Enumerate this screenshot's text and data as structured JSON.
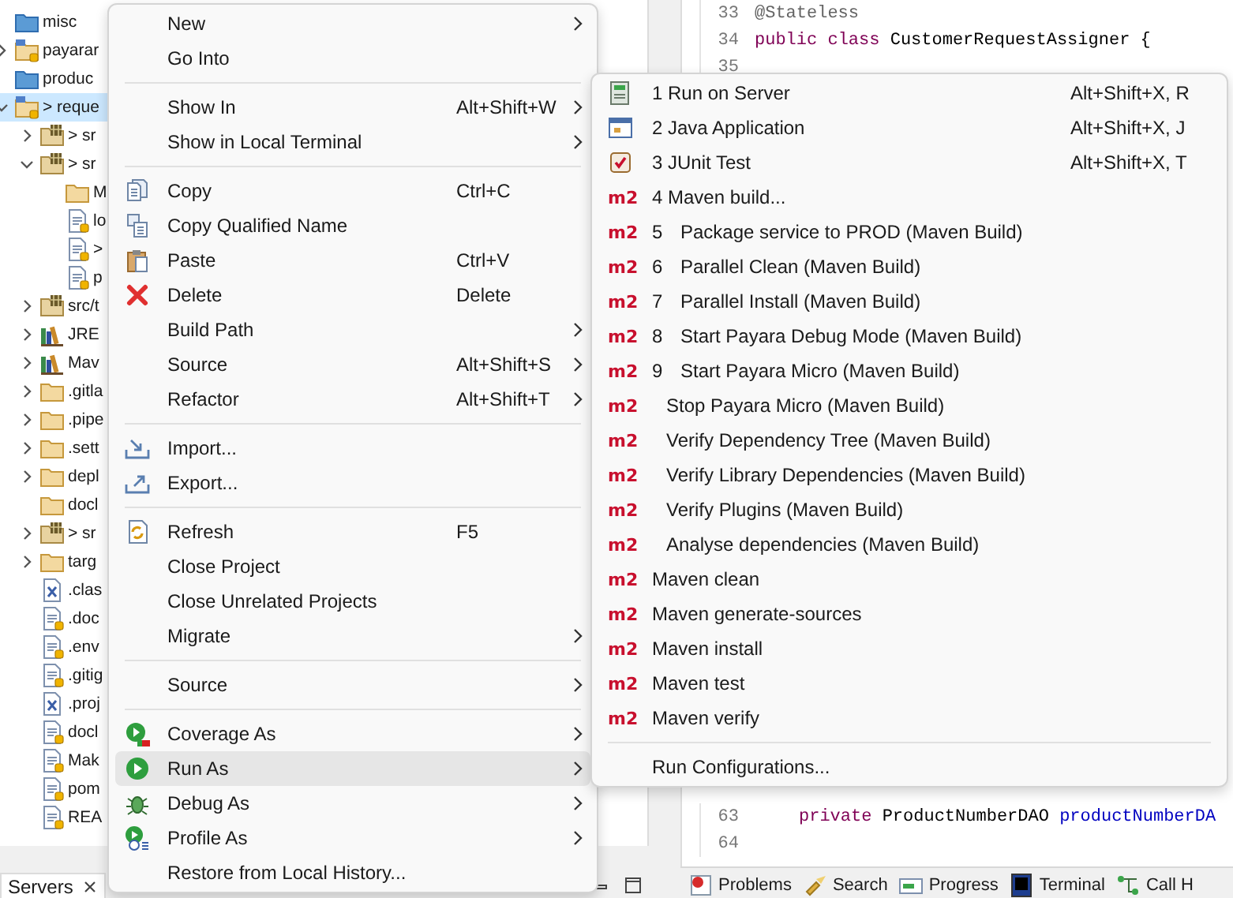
{
  "project_explorer": {
    "items": [
      {
        "label": "misc",
        "kind": "closed-folder",
        "selected": false
      },
      {
        "label": "payarar",
        "kind": "project",
        "expanded": false,
        "selected": false
      },
      {
        "label": "produc",
        "kind": "closed-folder",
        "selected": false
      },
      {
        "label": "> reque",
        "kind": "project",
        "expanded": true,
        "selected": true,
        "children": [
          {
            "label": "> sr",
            "kind": "source-folder",
            "expanded": false,
            "selected": false
          },
          {
            "label": "> sr",
            "kind": "source-folder",
            "expanded": true,
            "selected": false,
            "children": [
              {
                "label": "M",
                "kind": "folder",
                "selected": false
              },
              {
                "label": "lo",
                "kind": "file",
                "selected": false
              },
              {
                "label": ">",
                "kind": "file",
                "selected": false
              },
              {
                "label": "p",
                "kind": "file",
                "selected": false
              }
            ]
          },
          {
            "label": "src/t",
            "kind": "source-folder",
            "expanded": false,
            "selected": false
          },
          {
            "label": "JRE",
            "kind": "library",
            "expanded": false,
            "selected": false
          },
          {
            "label": "Mav",
            "kind": "library",
            "expanded": false,
            "selected": false
          },
          {
            "label": ".gitla",
            "kind": "folder",
            "expanded": false,
            "selected": false
          },
          {
            "label": ".pipe",
            "kind": "folder",
            "expanded": false,
            "selected": false
          },
          {
            "label": ".sett",
            "kind": "folder",
            "expanded": false,
            "selected": false
          },
          {
            "label": "depl",
            "kind": "folder",
            "expanded": false,
            "selected": false
          },
          {
            "label": "docl",
            "kind": "folder",
            "selected": false
          },
          {
            "label": "> sr",
            "kind": "source-folder",
            "expanded": false,
            "selected": false
          },
          {
            "label": "targ",
            "kind": "folder",
            "expanded": false,
            "selected": false
          },
          {
            "label": ".clas",
            "kind": "xml-file",
            "selected": false
          },
          {
            "label": ".doc",
            "kind": "file",
            "selected": false
          },
          {
            "label": ".env",
            "kind": "file",
            "selected": false
          },
          {
            "label": ".gitig",
            "kind": "file",
            "selected": false
          },
          {
            "label": ".proj",
            "kind": "xml-file",
            "selected": false
          },
          {
            "label": "docl",
            "kind": "file",
            "selected": false
          },
          {
            "label": "Mak",
            "kind": "file",
            "selected": false
          },
          {
            "label": "pom",
            "kind": "file",
            "selected": false
          },
          {
            "label": "REA",
            "kind": "file",
            "selected": false
          }
        ]
      }
    ]
  },
  "servers_tab": {
    "label": "Servers"
  },
  "editor": {
    "top_lines": [
      {
        "number": "33",
        "tokens": [
          {
            "kind": "annotation",
            "text": "@Stateless"
          }
        ]
      },
      {
        "number": "34",
        "tokens": [
          {
            "kind": "keyword",
            "text": "public"
          },
          {
            "kind": "keyword",
            "text": "class"
          },
          {
            "kind": "plain",
            "text": "CustomerRequestAssigner {"
          }
        ]
      },
      {
        "number": "35"
      }
    ],
    "bottom_lines": [
      {
        "number": "63",
        "indented": true,
        "tokens": [
          {
            "kind": "keyword",
            "text": "private"
          },
          {
            "kind": "plain",
            "text": "ProductNumberDAO"
          },
          {
            "kind": "field",
            "text": "productNumberDA"
          }
        ]
      },
      {
        "number": "64"
      }
    ]
  },
  "bottom_tabs": [
    {
      "label": "Problems",
      "kind": "problems"
    },
    {
      "label": "Search",
      "kind": "search"
    },
    {
      "label": "Progress",
      "kind": "progress"
    },
    {
      "label": "Terminal",
      "kind": "terminal"
    },
    {
      "label": "Call H",
      "kind": "call"
    }
  ],
  "context_menu": {
    "groups": [
      [
        {
          "label": "New",
          "has_submenu": true,
          "selected": false
        },
        {
          "label": "Go Into",
          "selected": false
        }
      ],
      [
        {
          "label": "Show In",
          "shortcut": "Alt+Shift+W",
          "has_submenu": true,
          "selected": false
        },
        {
          "label": "Show in Local Terminal",
          "has_submenu": true,
          "selected": false
        }
      ],
      [
        {
          "label": "Copy",
          "kind": "copy",
          "shortcut": "Ctrl+C",
          "selected": false
        },
        {
          "label": "Copy Qualified Name",
          "kind": "copy-qualified",
          "selected": false
        },
        {
          "label": "Paste",
          "kind": "paste",
          "shortcut": "Ctrl+V",
          "selected": false
        },
        {
          "label": "Delete",
          "kind": "delete",
          "shortcut": "Delete",
          "selected": false
        },
        {
          "label": "Build Path",
          "has_submenu": true,
          "selected": false
        },
        {
          "label": "Source",
          "shortcut": "Alt+Shift+S",
          "has_submenu": true,
          "selected": false
        },
        {
          "label": "Refactor",
          "shortcut": "Alt+Shift+T",
          "has_submenu": true,
          "selected": false
        }
      ],
      [
        {
          "label": "Import...",
          "kind": "import",
          "selected": false
        },
        {
          "label": "Export...",
          "kind": "export",
          "selected": false
        }
      ],
      [
        {
          "label": "Refresh",
          "kind": "refresh",
          "shortcut": "F5",
          "selected": false
        },
        {
          "label": "Close Project",
          "selected": false
        },
        {
          "label": "Close Unrelated Projects",
          "selected": false
        },
        {
          "label": "Migrate",
          "has_submenu": true,
          "selected": false
        }
      ],
      [
        {
          "label": "Source",
          "has_submenu": true,
          "selected": false
        }
      ],
      [
        {
          "label": "Coverage As",
          "kind": "coverage",
          "has_submenu": true,
          "selected": false
        },
        {
          "label": "Run As",
          "kind": "run",
          "has_submenu": true,
          "selected": true
        },
        {
          "label": "Debug As",
          "kind": "debug",
          "has_submenu": true,
          "selected": false
        },
        {
          "label": "Profile As",
          "kind": "profile",
          "has_submenu": true,
          "selected": false
        },
        {
          "label": "Restore from Local History...",
          "selected": false
        }
      ]
    ]
  },
  "run_as_submenu": {
    "groups": [
      [
        {
          "kind": "server",
          "label": "1 Run on Server",
          "shortcut": "Alt+Shift+X, R",
          "selected": false
        },
        {
          "kind": "java",
          "label": "2 Java Application",
          "shortcut": "Alt+Shift+X, J",
          "selected": false
        },
        {
          "kind": "junit",
          "label": "3 JUnit Test",
          "shortcut": "Alt+Shift+X, T",
          "selected": false
        },
        {
          "kind": "maven-goal",
          "label": "4 Maven build...",
          "badge": "m2",
          "selected": false
        },
        {
          "kind": "maven-config",
          "number": "5",
          "label": "Package service to PROD (Maven Build)",
          "badge": "m2",
          "selected": false
        },
        {
          "kind": "maven-config",
          "number": "6",
          "label": "Parallel Clean (Maven Build)",
          "badge": "m2",
          "selected": false
        },
        {
          "kind": "maven-config",
          "number": "7",
          "label": "Parallel Install (Maven Build)",
          "badge": "m2",
          "selected": false
        },
        {
          "kind": "maven-config",
          "number": "8",
          "label": "Start Payara Debug Mode (Maven Build)",
          "badge": "m2",
          "selected": false
        },
        {
          "kind": "maven-config",
          "number": "9",
          "label": "Start Payara Micro (Maven Build)",
          "badge": "m2",
          "selected": false
        },
        {
          "kind": "maven-config",
          "label": "Stop Payara Micro (Maven Build)",
          "badge": "m2",
          "selected": false
        },
        {
          "kind": "maven-config",
          "label": "Verify Dependency Tree (Maven Build)",
          "badge": "m2",
          "selected": false
        },
        {
          "kind": "maven-config",
          "label": "Verify Library Dependencies (Maven Build)",
          "badge": "m2",
          "selected": false
        },
        {
          "kind": "maven-config",
          "label": "Verify Plugins (Maven Build)",
          "badge": "m2",
          "selected": false
        },
        {
          "kind": "maven-config",
          "label": "Analyse dependencies (Maven Build)",
          "badge": "m2",
          "selected": false
        },
        {
          "kind": "maven-goal",
          "label": "Maven clean",
          "badge": "m2",
          "selected": false
        },
        {
          "kind": "maven-goal",
          "label": "Maven generate-sources",
          "badge": "m2",
          "selected": false
        },
        {
          "kind": "maven-goal",
          "label": "Maven install",
          "badge": "m2",
          "selected": false
        },
        {
          "kind": "maven-goal",
          "label": "Maven test",
          "badge": "m2",
          "selected": false
        },
        {
          "kind": "maven-goal",
          "label": "Maven verify",
          "badge": "m2",
          "selected": false
        }
      ],
      [
        {
          "kind": "configurations",
          "label": "Run Configurations...",
          "selected": false
        }
      ]
    ]
  }
}
